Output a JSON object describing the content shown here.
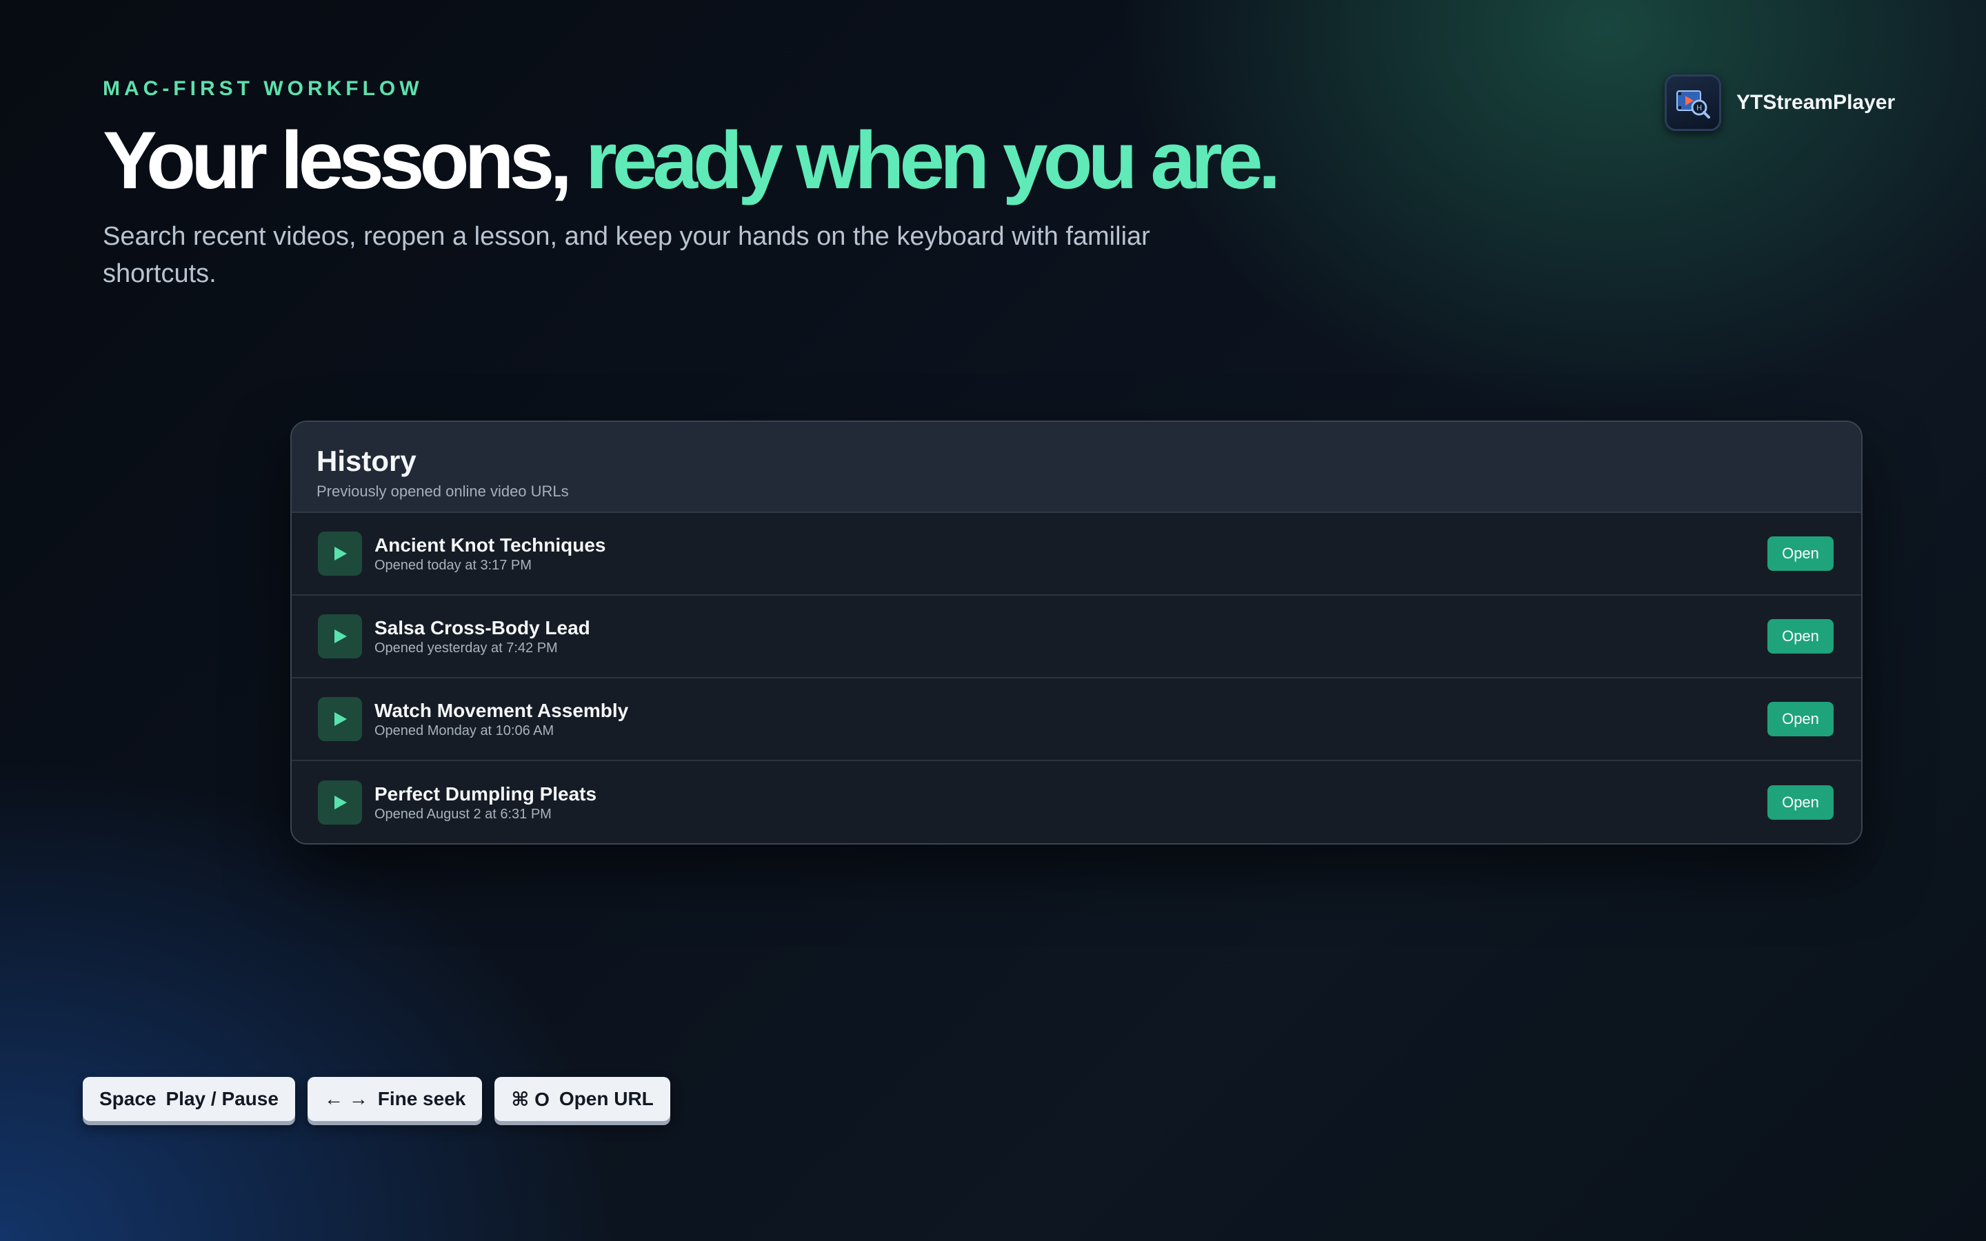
{
  "hero": {
    "eyebrow": "MAC-FIRST WORKFLOW",
    "headline_main": "Your lessons,",
    "headline_accent": "ready when you are.",
    "subtitle": "Search recent videos, reopen a lesson, and keep your hands on the keyboard with familiar shortcuts."
  },
  "brand": {
    "name": "YTStreamPlayer",
    "icon": "app-logo-icon"
  },
  "history": {
    "title": "History",
    "subtitle": "Previously opened online video URLs",
    "items": [
      {
        "title": "Ancient Knot Techniques",
        "meta": "Opened today at 3:17 PM",
        "action": "Open"
      },
      {
        "title": "Salsa Cross-Body Lead",
        "meta": "Opened yesterday at 7:42 PM",
        "action": "Open"
      },
      {
        "title": "Watch Movement Assembly",
        "meta": "Opened Monday at 10:06 AM",
        "action": "Open"
      },
      {
        "title": "Perfect Dumpling Pleats",
        "meta": "Opened August 2 at 6:31 PM",
        "action": "Open"
      }
    ]
  },
  "shortcuts": [
    {
      "key": "Space",
      "label": "Play / Pause"
    },
    {
      "key": "← →",
      "label": "Fine seek"
    },
    {
      "key": "⌘ O",
      "label": "Open URL"
    }
  ],
  "colors": {
    "accent": "#5feab8",
    "button": "#1ea37a",
    "panel": "#161c25"
  }
}
